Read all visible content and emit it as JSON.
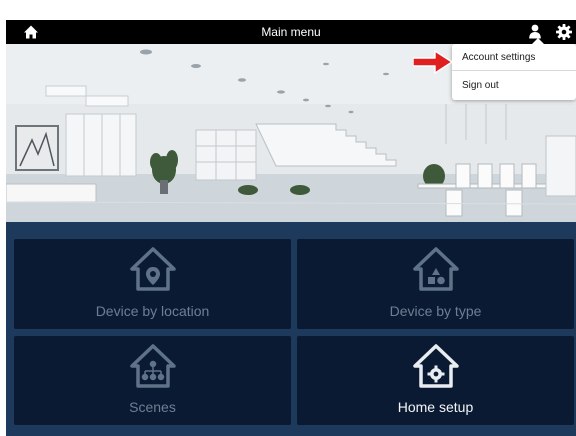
{
  "header": {
    "title": "Main menu",
    "home_icon": "home-icon",
    "user_icon": "user-icon",
    "settings_icon": "gear-icon"
  },
  "account_menu": {
    "items": [
      {
        "label": "Account settings"
      },
      {
        "label": "Sign out"
      }
    ]
  },
  "tiles": [
    {
      "label": "Device by location",
      "icon": "house-location-pin-icon",
      "state": "dim"
    },
    {
      "label": "Device by type",
      "icon": "house-device-type-icon",
      "state": "dim"
    },
    {
      "label": "Scenes",
      "icon": "house-scenes-icon",
      "state": "dim"
    },
    {
      "label": "Home setup",
      "icon": "house-gear-icon",
      "state": "lit"
    }
  ],
  "colors": {
    "topbar": "#000000",
    "tile_background": "#0b1a33",
    "panel_background": "#1d3a5c",
    "dim_text": "#6d7f92",
    "highlight_arrow": "#e02020"
  }
}
